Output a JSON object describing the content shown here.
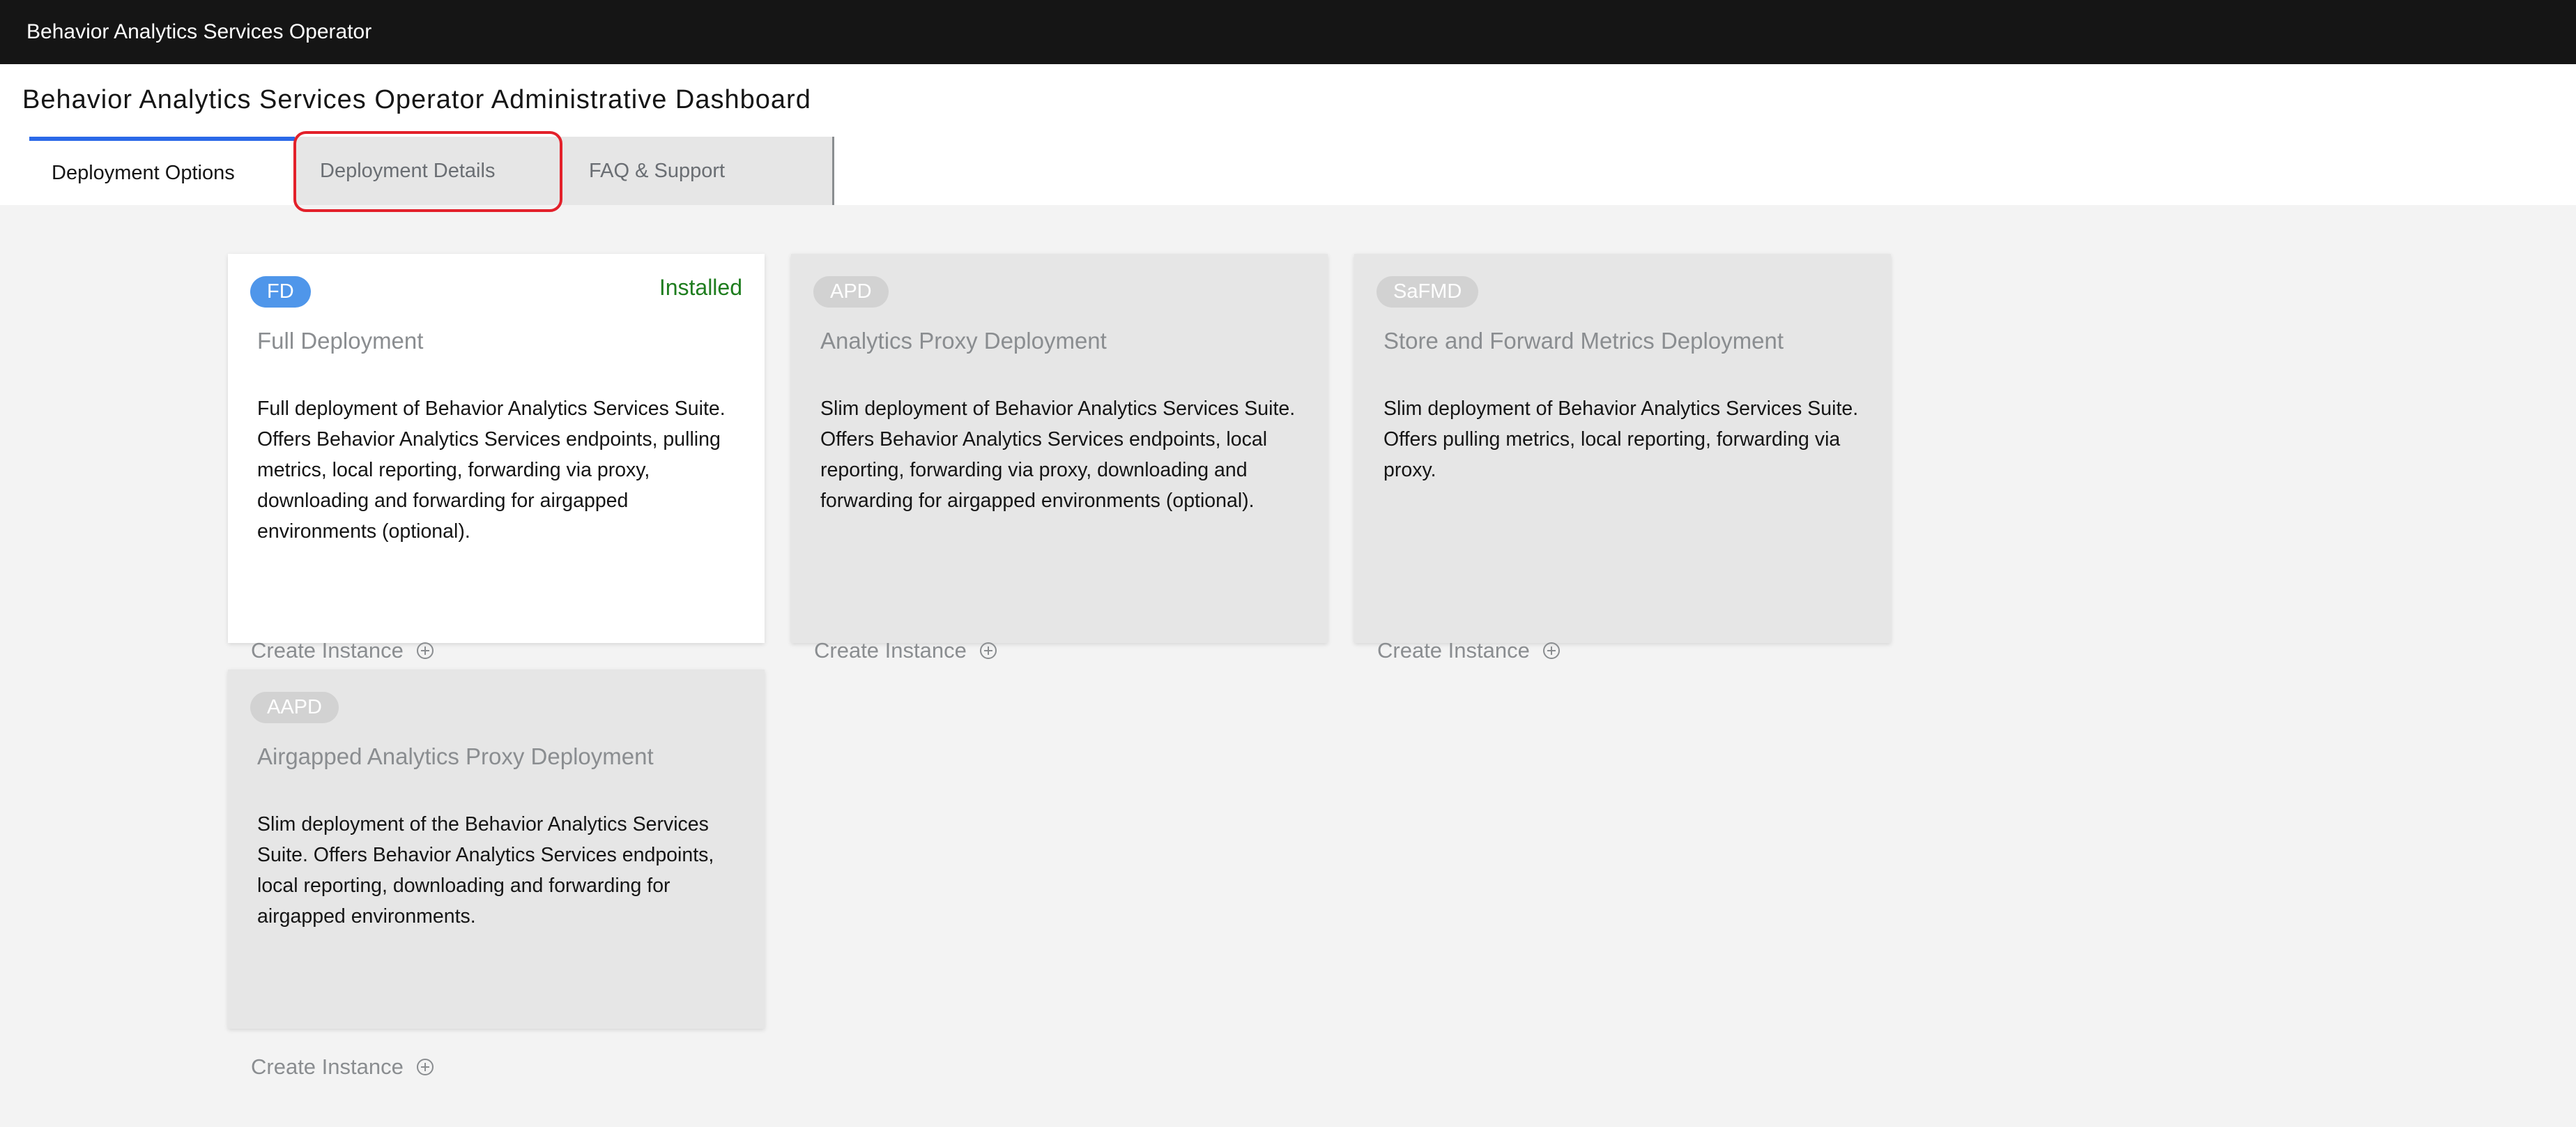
{
  "app": {
    "title": "Behavior Analytics Services Operator"
  },
  "page": {
    "title": "Behavior Analytics Services Operator Administrative Dashboard"
  },
  "tabs": [
    {
      "label": "Deployment Options",
      "active": true
    },
    {
      "label": "Deployment Details",
      "active": false
    },
    {
      "label": "FAQ & Support",
      "active": false
    }
  ],
  "cards": [
    {
      "badge": "FD",
      "status": "Installed",
      "title": "Full Deployment",
      "description": "Full deployment of Behavior Analytics Services Suite. Offers Behavior Analytics Services endpoints, pulling metrics, local reporting, forwarding via proxy, downloading and forwarding for airgapped environments (optional).",
      "action": "Create Instance",
      "action_icon": "plus-circle-icon"
    },
    {
      "badge": "APD",
      "status": "",
      "title": "Analytics Proxy Deployment",
      "description": "Slim deployment of Behavior Analytics Services Suite. Offers Behavior Analytics Services endpoints, local reporting, forwarding via proxy, downloading and forwarding for airgapped environments (optional).",
      "action": "Create Instance",
      "action_icon": "plus-circle-icon"
    },
    {
      "badge": "SaFMD",
      "status": "",
      "title": "Store and Forward Metrics Deployment",
      "description": "Slim deployment of Behavior Analytics Services Suite. Offers pulling metrics, local reporting, forwarding via proxy.",
      "action": "Create Instance",
      "action_icon": "plus-circle-icon"
    },
    {
      "badge": "AAPD",
      "status": "",
      "title": "Airgapped Analytics Proxy Deployment",
      "description": "Slim deployment of the Behavior Analytics Services Suite. Offers Behavior Analytics Services endpoints, local reporting, downloading and forwarding for airgapped environments.",
      "action": "Create Instance",
      "action_icon": "plus-circle-icon"
    }
  ],
  "colors": {
    "topbar": "#151515",
    "active_tab_accent": "#2b69e8",
    "installed_badge": "#4f96ea",
    "installed_text": "#1e7d1e",
    "highlight": "#e3202a"
  }
}
